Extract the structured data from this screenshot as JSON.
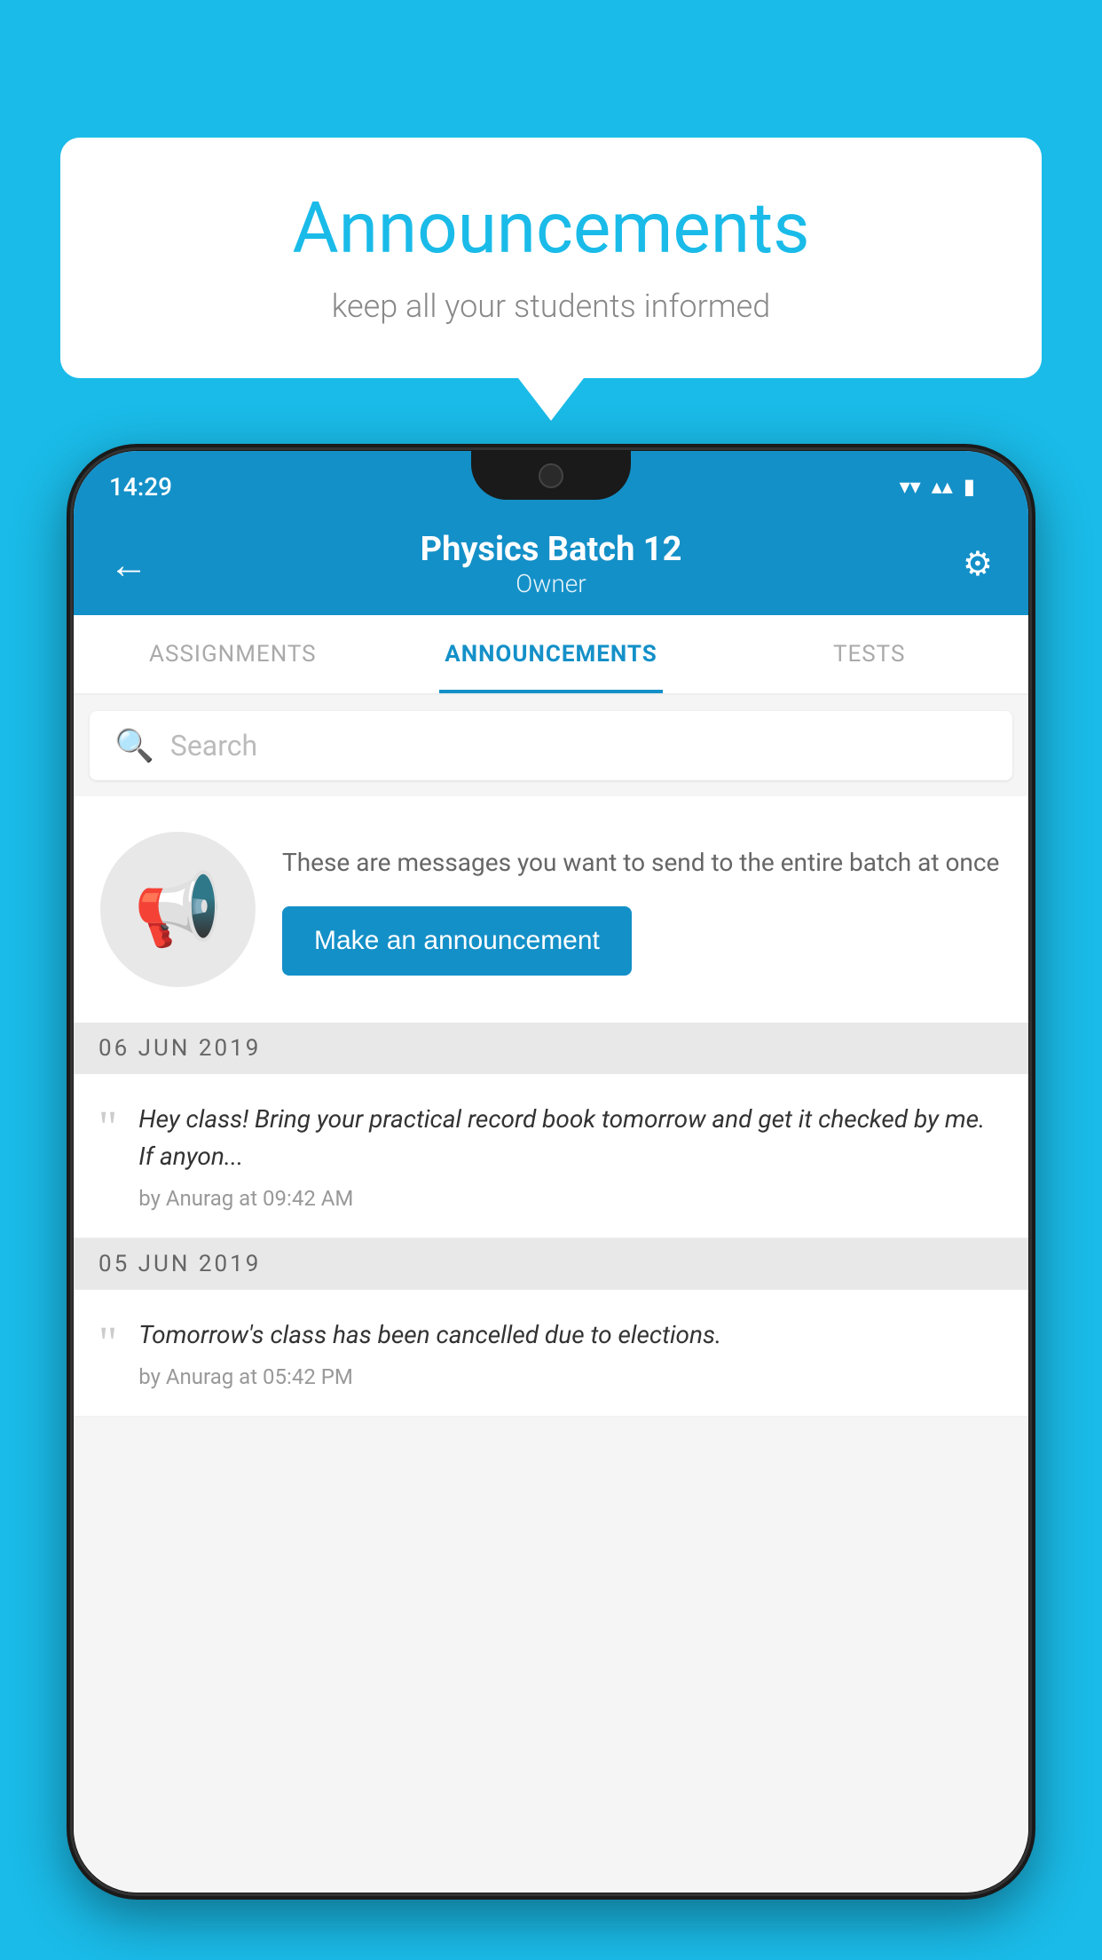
{
  "page": {
    "background_color": "#1ABBE8"
  },
  "speech_bubble": {
    "title": "Announcements",
    "subtitle": "keep all your students informed"
  },
  "status_bar": {
    "time": "14:29",
    "wifi": "▾",
    "signal": "▴",
    "battery": "▮"
  },
  "header": {
    "batch_name": "Physics Batch 12",
    "role": "Owner",
    "back_label": "←",
    "settings_label": "⚙"
  },
  "tabs": [
    {
      "label": "ASSIGNMENTS",
      "active": false
    },
    {
      "label": "ANNOUNCEMENTS",
      "active": true
    },
    {
      "label": "TESTS",
      "active": false
    }
  ],
  "search": {
    "placeholder": "Search"
  },
  "cta": {
    "description": "These are messages you want to send to the entire batch at once",
    "button_label": "Make an announcement"
  },
  "announcements": [
    {
      "date": "06  JUN  2019",
      "message": "Hey class! Bring your practical record book tomorrow and get it checked by me. If anyon...",
      "meta": "by Anurag at 09:42 AM"
    },
    {
      "date": "05  JUN  2019",
      "message": "Tomorrow's class has been cancelled due to elections.",
      "meta": "by Anurag at 05:42 PM"
    }
  ]
}
